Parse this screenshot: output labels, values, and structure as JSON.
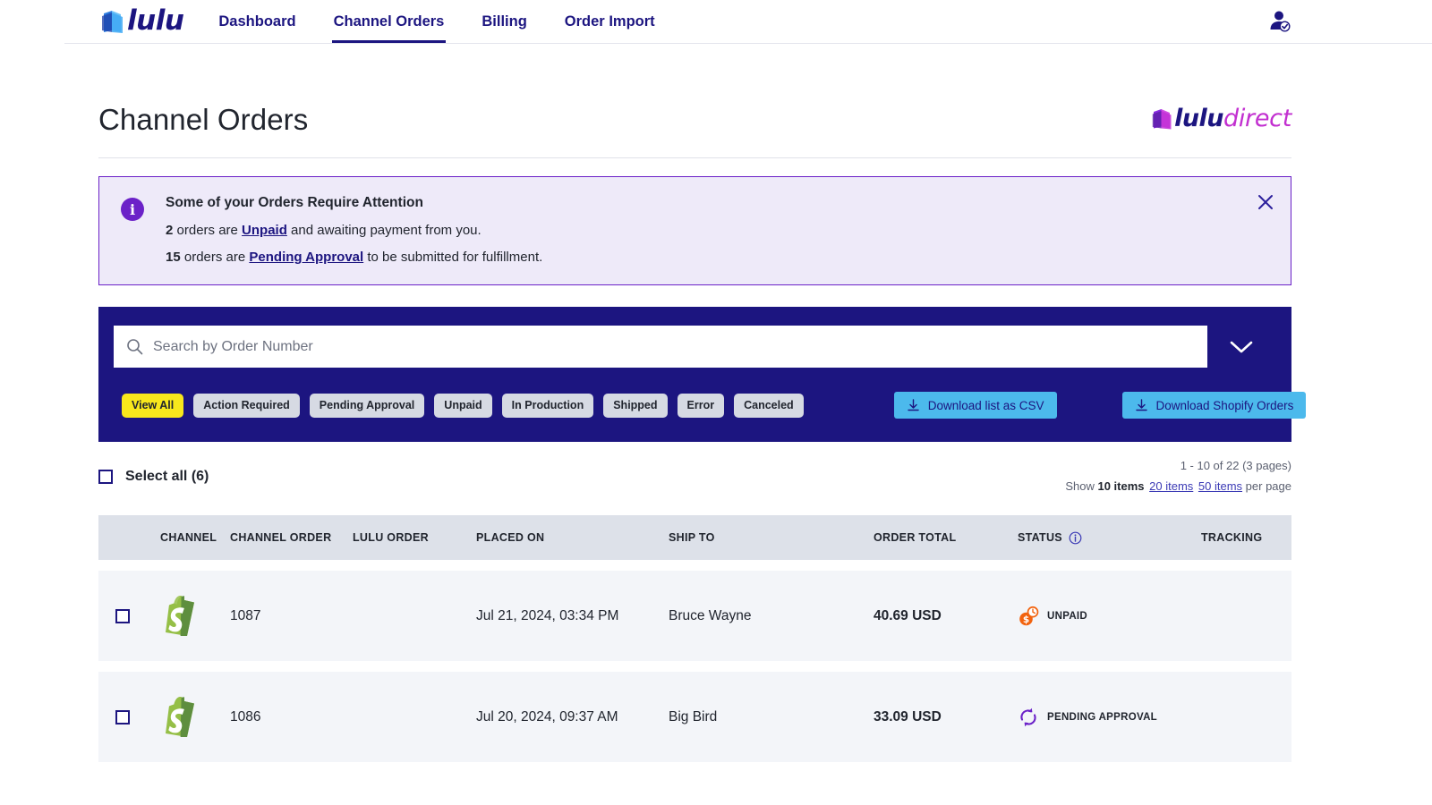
{
  "nav": {
    "logo_text": "lulu",
    "links": [
      {
        "label": "Dashboard",
        "active": false
      },
      {
        "label": "Channel Orders",
        "active": true
      },
      {
        "label": "Billing",
        "active": false
      },
      {
        "label": "Order Import",
        "active": false
      }
    ],
    "avatar_icon": "user-verified-icon"
  },
  "header": {
    "title": "Channel Orders",
    "brand_primary": "lulu",
    "brand_secondary": "direct"
  },
  "alert": {
    "icon": "info-icon",
    "title": "Some of your Orders Require Attention",
    "line1_count": "2",
    "line1_pre": " orders are ",
    "line1_link": "Unpaid",
    "line1_post": " and awaiting payment from you.",
    "line2_count": "15",
    "line2_pre": " orders are ",
    "line2_link": "Pending Approval",
    "line2_post": " to be submitted for fulfillment.",
    "close_icon": "close-icon"
  },
  "search": {
    "placeholder": "Search by Order Number",
    "value": "",
    "icon": "search-icon",
    "expand_icon": "chevron-down-icon"
  },
  "filters": [
    {
      "label": "View All",
      "active": true
    },
    {
      "label": "Action Required",
      "active": false
    },
    {
      "label": "Pending Approval",
      "active": false
    },
    {
      "label": "Unpaid",
      "active": false
    },
    {
      "label": "In Production",
      "active": false
    },
    {
      "label": "Shipped",
      "active": false
    },
    {
      "label": "Error",
      "active": false
    },
    {
      "label": "Canceled",
      "active": false
    }
  ],
  "downloads": {
    "csv_label": "Download list as CSV",
    "shopify_label": "Download Shopify Orders",
    "icon": "download-icon"
  },
  "listmeta": {
    "select_all_label": "Select all (6)",
    "range_text": "1 - 10 of 22 (3 pages)",
    "show_label": "Show",
    "per_page_label": "per page",
    "page_sizes": [
      {
        "label": "10 items",
        "selected": true
      },
      {
        "label": "20 items",
        "selected": false
      },
      {
        "label": "50 items",
        "selected": false
      }
    ]
  },
  "table": {
    "columns": [
      "CHANNEL",
      "CHANNEL ORDER",
      "LULU ORDER",
      "PLACED ON",
      "SHIP TO",
      "ORDER TOTAL",
      "STATUS",
      "TRACKING"
    ],
    "status_info_icon": "info-circle-icon",
    "rows": [
      {
        "checked": false,
        "channel_icon": "shopify-icon",
        "channel_order": "1087",
        "lulu_order": "",
        "placed_on": "Jul 21, 2024, 03:34 PM",
        "ship_to": "Bruce Wayne",
        "order_total": "40.69 USD",
        "status_label": "UNPAID",
        "status_icon": "coin-clock-icon",
        "tracking": ""
      },
      {
        "checked": false,
        "channel_icon": "shopify-icon",
        "channel_order": "1086",
        "lulu_order": "",
        "placed_on": "Jul 20, 2024, 09:37 AM",
        "ship_to": "Big Bird",
        "order_total": "33.09 USD",
        "status_label": "PENDING APPROVAL",
        "status_icon": "refresh-arrows-icon",
        "tracking": ""
      }
    ]
  },
  "colors": {
    "brand_navy": "#1c1580",
    "accent_yellow": "#f8e71c",
    "accent_blue": "#4cb9ec",
    "alert_purple": "#6b21c8",
    "shopify_green": "#95bf47",
    "unpaid_orange": "#f2630f",
    "pending_purple": "#6b21c8"
  }
}
